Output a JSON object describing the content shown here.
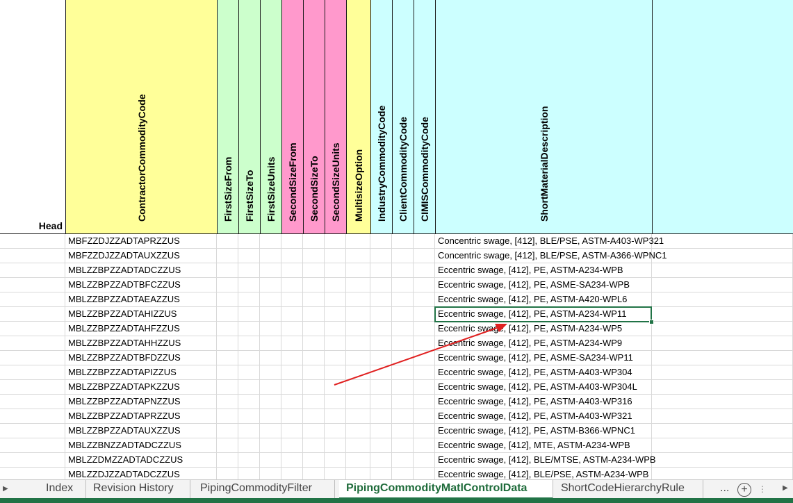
{
  "head_label": "Head",
  "columns": [
    {
      "name": "ContractorCommodityCode",
      "color": "#ffff99"
    },
    {
      "name": "FirstSizeFrom",
      "color": "#ccffcc"
    },
    {
      "name": "FirstSizeTo",
      "color": "#ccffcc"
    },
    {
      "name": "FirstSizeUnits",
      "color": "#ccffcc"
    },
    {
      "name": "SecondSizeFrom",
      "color": "#ff99cc"
    },
    {
      "name": "SecondSizeTo",
      "color": "#ff99cc"
    },
    {
      "name": "SecondSizeUnits",
      "color": "#ff99cc"
    },
    {
      "name": "MultisizeOption",
      "color": "#ffff99"
    },
    {
      "name": "IndustryCommodityCode",
      "color": "#ccffff"
    },
    {
      "name": "ClientCommodityCode",
      "color": "#ccffff"
    },
    {
      "name": "CIMISCommodityCode",
      "color": "#ccffff"
    },
    {
      "name": "ShortMaterialDescription",
      "color": "#ccffff"
    }
  ],
  "rows": [
    {
      "code": "MBFZZDJZZADTAPRZZUS",
      "desc": "Concentric swage, [412], BLE/PSE, ASTM-A403-WP321"
    },
    {
      "code": "MBFZZDJZZADTAUXZZUS",
      "desc": "Concentric swage, [412], BLE/PSE, ASTM-A366-WPNC1"
    },
    {
      "code": "MBLZZBPZZADTADCZZUS",
      "desc": "Eccentric swage, [412], PE, ASTM-A234-WPB"
    },
    {
      "code": "MBLZZBPZZADTBFCZZUS",
      "desc": "Eccentric swage, [412], PE, ASME-SA234-WPB"
    },
    {
      "code": "MBLZZBPZZADTAEAZZUS",
      "desc": "Eccentric swage, [412], PE, ASTM-A420-WPL6"
    },
    {
      "code": "MBLZZBPZZADTAHIZZUS",
      "desc": "Eccentric swage, [412], PE, ASTM-A234-WP11"
    },
    {
      "code": "MBLZZBPZZADTAHFZZUS",
      "desc": "Eccentric swage, [412], PE, ASTM-A234-WP5"
    },
    {
      "code": "MBLZZBPZZADTAHHZZUS",
      "desc": "Eccentric swage, [412], PE, ASTM-A234-WP9"
    },
    {
      "code": "MBLZZBPZZADTBFDZZUS",
      "desc": "Eccentric swage, [412], PE, ASME-SA234-WP11"
    },
    {
      "code": "MBLZZBPZZADTAPIZZUS",
      "desc": "Eccentric swage, [412], PE, ASTM-A403-WP304"
    },
    {
      "code": "MBLZZBPZZADTAPKZZUS",
      "desc": "Eccentric swage, [412], PE, ASTM-A403-WP304L"
    },
    {
      "code": "MBLZZBPZZADTAPNZZUS",
      "desc": "Eccentric swage, [412], PE, ASTM-A403-WP316"
    },
    {
      "code": "MBLZZBPZZADTAPRZZUS",
      "desc": "Eccentric swage, [412], PE, ASTM-A403-WP321"
    },
    {
      "code": "MBLZZBPZZADTAUXZZUS",
      "desc": "Eccentric swage, [412], PE, ASTM-B366-WPNC1"
    },
    {
      "code": "MBLZZBNZZADTADCZZUS",
      "desc": "Eccentric swage, [412], MTE, ASTM-A234-WPB"
    },
    {
      "code": "MBLZZDMZZADTADCZZUS",
      "desc": "Eccentric swage, [412], BLE/MTSE, ASTM-A234-WPB"
    },
    {
      "code": "MBLZZDJZZADTADCZZUS",
      "desc": "Eccentric swage, [412], BLE/PSE, ASTM-A234-WPB"
    }
  ],
  "selected_row": 5,
  "sheet_tabs": [
    {
      "label": "Index",
      "active": false
    },
    {
      "label": "Revision History",
      "active": false
    },
    {
      "label": "PipingCommodityFilter",
      "active": false
    },
    {
      "label": "PipingCommodityMatlControlData",
      "active": true
    },
    {
      "label": "ShortCodeHierarchyRule",
      "active": false
    }
  ],
  "more_label": "...",
  "add_label": "+",
  "annotation_color": "#e02020",
  "accent_color": "#217346"
}
